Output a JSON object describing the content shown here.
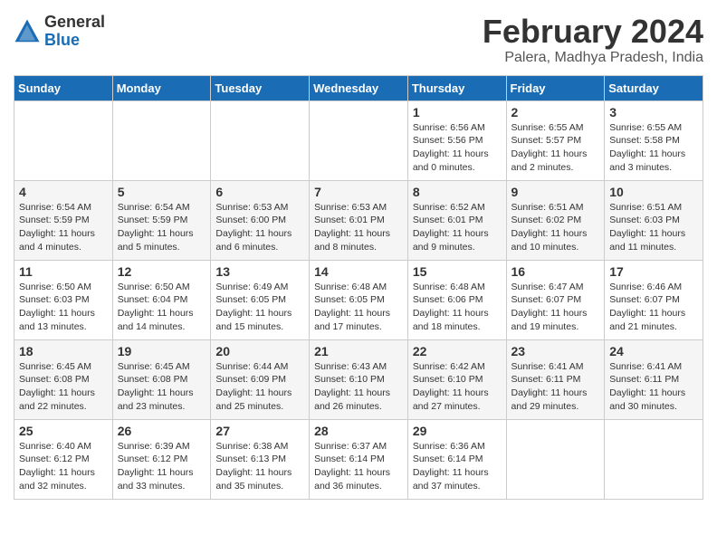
{
  "header": {
    "logo_general": "General",
    "logo_blue": "Blue",
    "month_year": "February 2024",
    "location": "Palera, Madhya Pradesh, India"
  },
  "days_of_week": [
    "Sunday",
    "Monday",
    "Tuesday",
    "Wednesday",
    "Thursday",
    "Friday",
    "Saturday"
  ],
  "weeks": [
    [
      {
        "day": "",
        "info": ""
      },
      {
        "day": "",
        "info": ""
      },
      {
        "day": "",
        "info": ""
      },
      {
        "day": "",
        "info": ""
      },
      {
        "day": "1",
        "info": "Sunrise: 6:56 AM\nSunset: 5:56 PM\nDaylight: 11 hours\nand 0 minutes."
      },
      {
        "day": "2",
        "info": "Sunrise: 6:55 AM\nSunset: 5:57 PM\nDaylight: 11 hours\nand 2 minutes."
      },
      {
        "day": "3",
        "info": "Sunrise: 6:55 AM\nSunset: 5:58 PM\nDaylight: 11 hours\nand 3 minutes."
      }
    ],
    [
      {
        "day": "4",
        "info": "Sunrise: 6:54 AM\nSunset: 5:59 PM\nDaylight: 11 hours\nand 4 minutes."
      },
      {
        "day": "5",
        "info": "Sunrise: 6:54 AM\nSunset: 5:59 PM\nDaylight: 11 hours\nand 5 minutes."
      },
      {
        "day": "6",
        "info": "Sunrise: 6:53 AM\nSunset: 6:00 PM\nDaylight: 11 hours\nand 6 minutes."
      },
      {
        "day": "7",
        "info": "Sunrise: 6:53 AM\nSunset: 6:01 PM\nDaylight: 11 hours\nand 8 minutes."
      },
      {
        "day": "8",
        "info": "Sunrise: 6:52 AM\nSunset: 6:01 PM\nDaylight: 11 hours\nand 9 minutes."
      },
      {
        "day": "9",
        "info": "Sunrise: 6:51 AM\nSunset: 6:02 PM\nDaylight: 11 hours\nand 10 minutes."
      },
      {
        "day": "10",
        "info": "Sunrise: 6:51 AM\nSunset: 6:03 PM\nDaylight: 11 hours\nand 11 minutes."
      }
    ],
    [
      {
        "day": "11",
        "info": "Sunrise: 6:50 AM\nSunset: 6:03 PM\nDaylight: 11 hours\nand 13 minutes."
      },
      {
        "day": "12",
        "info": "Sunrise: 6:50 AM\nSunset: 6:04 PM\nDaylight: 11 hours\nand 14 minutes."
      },
      {
        "day": "13",
        "info": "Sunrise: 6:49 AM\nSunset: 6:05 PM\nDaylight: 11 hours\nand 15 minutes."
      },
      {
        "day": "14",
        "info": "Sunrise: 6:48 AM\nSunset: 6:05 PM\nDaylight: 11 hours\nand 17 minutes."
      },
      {
        "day": "15",
        "info": "Sunrise: 6:48 AM\nSunset: 6:06 PM\nDaylight: 11 hours\nand 18 minutes."
      },
      {
        "day": "16",
        "info": "Sunrise: 6:47 AM\nSunset: 6:07 PM\nDaylight: 11 hours\nand 19 minutes."
      },
      {
        "day": "17",
        "info": "Sunrise: 6:46 AM\nSunset: 6:07 PM\nDaylight: 11 hours\nand 21 minutes."
      }
    ],
    [
      {
        "day": "18",
        "info": "Sunrise: 6:45 AM\nSunset: 6:08 PM\nDaylight: 11 hours\nand 22 minutes."
      },
      {
        "day": "19",
        "info": "Sunrise: 6:45 AM\nSunset: 6:08 PM\nDaylight: 11 hours\nand 23 minutes."
      },
      {
        "day": "20",
        "info": "Sunrise: 6:44 AM\nSunset: 6:09 PM\nDaylight: 11 hours\nand 25 minutes."
      },
      {
        "day": "21",
        "info": "Sunrise: 6:43 AM\nSunset: 6:10 PM\nDaylight: 11 hours\nand 26 minutes."
      },
      {
        "day": "22",
        "info": "Sunrise: 6:42 AM\nSunset: 6:10 PM\nDaylight: 11 hours\nand 27 minutes."
      },
      {
        "day": "23",
        "info": "Sunrise: 6:41 AM\nSunset: 6:11 PM\nDaylight: 11 hours\nand 29 minutes."
      },
      {
        "day": "24",
        "info": "Sunrise: 6:41 AM\nSunset: 6:11 PM\nDaylight: 11 hours\nand 30 minutes."
      }
    ],
    [
      {
        "day": "25",
        "info": "Sunrise: 6:40 AM\nSunset: 6:12 PM\nDaylight: 11 hours\nand 32 minutes."
      },
      {
        "day": "26",
        "info": "Sunrise: 6:39 AM\nSunset: 6:12 PM\nDaylight: 11 hours\nand 33 minutes."
      },
      {
        "day": "27",
        "info": "Sunrise: 6:38 AM\nSunset: 6:13 PM\nDaylight: 11 hours\nand 35 minutes."
      },
      {
        "day": "28",
        "info": "Sunrise: 6:37 AM\nSunset: 6:14 PM\nDaylight: 11 hours\nand 36 minutes."
      },
      {
        "day": "29",
        "info": "Sunrise: 6:36 AM\nSunset: 6:14 PM\nDaylight: 11 hours\nand 37 minutes."
      },
      {
        "day": "",
        "info": ""
      },
      {
        "day": "",
        "info": ""
      }
    ]
  ]
}
